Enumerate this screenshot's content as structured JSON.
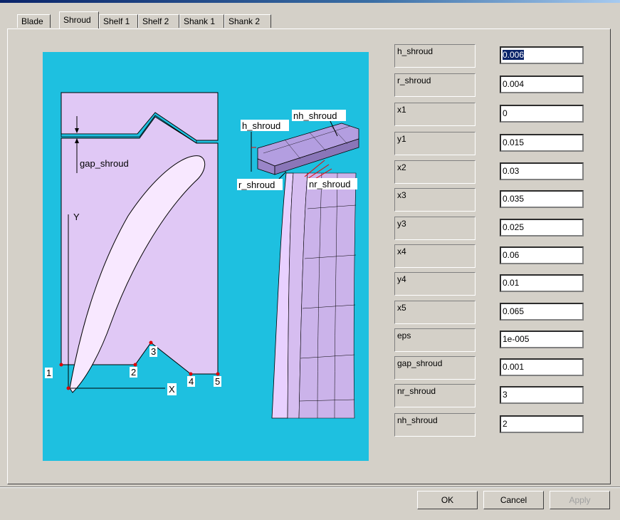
{
  "tabs": [
    "Blade",
    "Shroud",
    "Shelf 1",
    "Shelf 2",
    "Shank 1",
    "Shank 2"
  ],
  "active_tab": "Shroud",
  "figure": {
    "labels": {
      "gap_shroud": "gap_shroud",
      "y_axis": "Y",
      "x_axis": "X",
      "h_shroud": "h_shroud",
      "nh_shroud": "nh_shroud",
      "r_shroud": "r_shroud",
      "nr_shroud": "nr_shroud"
    },
    "points": [
      "1",
      "2",
      "3",
      "4",
      "5"
    ]
  },
  "params": [
    {
      "label": "h_shroud",
      "value": "0.006",
      "selected": true
    },
    {
      "label": "r_shroud",
      "value": "0.004"
    },
    {
      "label": "x1",
      "value": "0"
    },
    {
      "label": "y1",
      "value": "0.015"
    },
    {
      "label": "x2",
      "value": "0.03"
    },
    {
      "label": "x3",
      "value": "0.035"
    },
    {
      "label": "y3",
      "value": "0.025"
    },
    {
      "label": "x4",
      "value": "0.06"
    },
    {
      "label": "y4",
      "value": "0.01"
    },
    {
      "label": "x5",
      "value": "0.065"
    },
    {
      "label": "eps",
      "value": "1e-005"
    },
    {
      "label": "gap_shroud",
      "value": "0.001"
    },
    {
      "label": "nr_shroud",
      "value": "3"
    },
    {
      "label": "nh_shroud",
      "value": "2"
    }
  ],
  "buttons": {
    "ok": "OK",
    "cancel": "Cancel",
    "apply": "Apply"
  },
  "colors": {
    "figure_bg": "#1ec0e0",
    "body_fill": "#e0c8f5",
    "active_selection": "#0a246a"
  }
}
